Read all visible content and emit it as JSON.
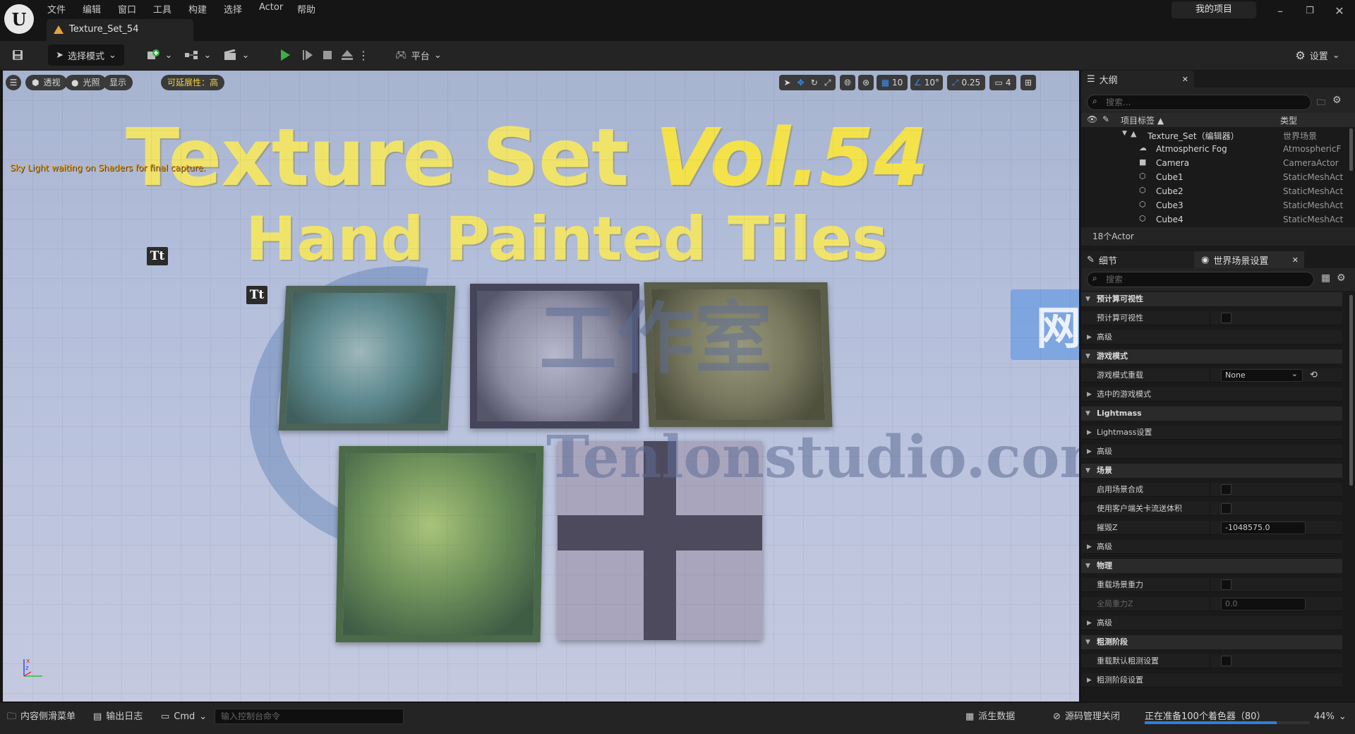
{
  "app": {
    "project_label": "我的项目",
    "tab_title": "Texture_Set_54"
  },
  "menu": [
    "文件",
    "编辑",
    "窗口",
    "工具",
    "构建",
    "选择",
    "Actor",
    "帮助"
  ],
  "toolbar": {
    "mode_label": "选择模式",
    "platform_label": "平台",
    "settings_label": "设置"
  },
  "viewport": {
    "buttons": {
      "perspective": "透视",
      "lighting": "光照",
      "show": "显示",
      "scalability": "可延展性：高"
    },
    "grid_snap": "10",
    "rot_snap": "10°",
    "scale_snap": "0.25",
    "cam_speed": "4",
    "message": "Sky Light waiting on Shaders for final capture.",
    "scene_title_1": "Texture Set ",
    "scene_title_vol": "Vol.54",
    "scene_title_2": "Hand Painted Tiles",
    "text_actor_glyph": "Tt",
    "watermark_cn": "工作室",
    "watermark_badge": "网站",
    "watermark_url": "Tenlonstudio.com",
    "axis_x": "x",
    "axis_z": "z"
  },
  "outliner": {
    "tab_label": "大纲",
    "search_placeholder": "搜索...",
    "col_label": "项目标签 ▲",
    "col_type": "类型",
    "items": [
      {
        "label": "Texture_Set（编辑器）",
        "type": "世界场景"
      },
      {
        "label": "Atmospheric Fog",
        "type": "AtmosphericF"
      },
      {
        "label": "Camera",
        "type": "CameraActor"
      },
      {
        "label": "Cube1",
        "type": "StaticMeshAct"
      },
      {
        "label": "Cube2",
        "type": "StaticMeshAct"
      },
      {
        "label": "Cube3",
        "type": "StaticMeshAct"
      },
      {
        "label": "Cube4",
        "type": "StaticMeshAct"
      }
    ],
    "actor_count": "18个Actor"
  },
  "details": {
    "tab_label": "细节",
    "world_tab_label": "世界场景设置",
    "search_placeholder": "搜索",
    "rows": [
      {
        "kind": "cat",
        "label": "预计算可视性",
        "open": true
      },
      {
        "kind": "prop",
        "label": "预计算可视性",
        "control": "check"
      },
      {
        "kind": "sub",
        "label": "高级"
      },
      {
        "kind": "cat",
        "label": "游戏模式",
        "open": true
      },
      {
        "kind": "prop",
        "label": "游戏模式重载",
        "control": "select",
        "value": "None"
      },
      {
        "kind": "sub",
        "label": "选中的游戏模式"
      },
      {
        "kind": "cat",
        "label": "Lightmass",
        "open": true
      },
      {
        "kind": "sub",
        "label": "Lightmass设置"
      },
      {
        "kind": "sub",
        "label": "高级"
      },
      {
        "kind": "cat",
        "label": "场景",
        "open": true
      },
      {
        "kind": "prop",
        "label": "启用场景合成",
        "control": "check"
      },
      {
        "kind": "prop",
        "label": "使用客户端关卡流送体积",
        "control": "check"
      },
      {
        "kind": "prop",
        "label": "摧毁Z",
        "control": "input",
        "value": "-1048575.0"
      },
      {
        "kind": "sub",
        "label": "高级"
      },
      {
        "kind": "cat",
        "label": "物理",
        "open": true
      },
      {
        "kind": "prop",
        "label": "重载场景重力",
        "control": "check"
      },
      {
        "kind": "prop",
        "label": "全局重力Z",
        "control": "input",
        "value": "0.0",
        "disabled": true
      },
      {
        "kind": "sub",
        "label": "高级"
      },
      {
        "kind": "cat",
        "label": "粗测阶段",
        "open": true
      },
      {
        "kind": "prop",
        "label": "重载默认粗测设置",
        "control": "check"
      },
      {
        "kind": "sub",
        "label": "粗测阶段设置"
      }
    ]
  },
  "status": {
    "content_drawer": "内容侧滑菜单",
    "output_log": "输出日志",
    "cmd": "Cmd",
    "console_placeholder": "输入控制台命令",
    "derived_data": "派生数据",
    "source_control": "源码管理关闭",
    "shader_progress": "正在准备100个着色器（80）",
    "shader_progress_value": 0.8,
    "zoom": "44%"
  },
  "colors": {
    "accent_play": "#3cb043",
    "title_yellow": "#f0e36a",
    "progress_blue": "#2f7fdc"
  }
}
